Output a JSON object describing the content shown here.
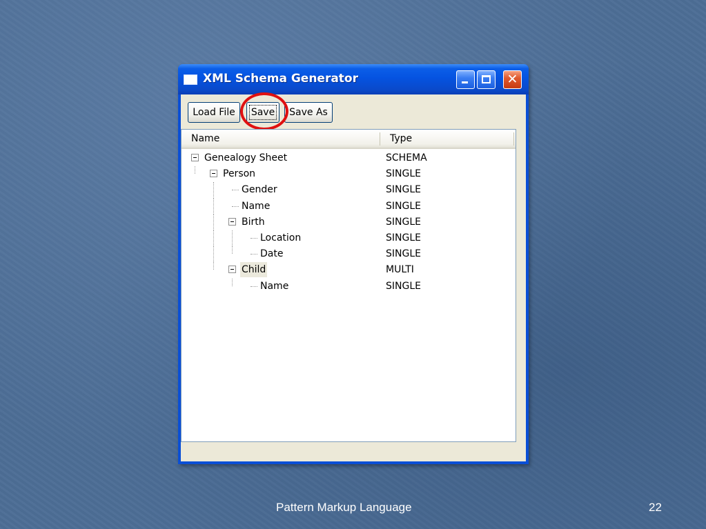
{
  "window": {
    "title": "XML Schema Generator"
  },
  "toolbar": {
    "load_label": "Load File",
    "save_label": "Save",
    "save_as_label": "Save As"
  },
  "list": {
    "columns": [
      "Name",
      "Type"
    ],
    "rows": [
      {
        "name": "Genealogy Sheet",
        "type": "SCHEMA",
        "depth": 0,
        "expanded": true
      },
      {
        "name": "Person",
        "type": "SINGLE",
        "depth": 1,
        "expanded": true
      },
      {
        "name": "Gender",
        "type": "SINGLE",
        "depth": 2,
        "expanded": null
      },
      {
        "name": "Name",
        "type": "SINGLE",
        "depth": 2,
        "expanded": null
      },
      {
        "name": "Birth",
        "type": "SINGLE",
        "depth": 2,
        "expanded": true
      },
      {
        "name": "Location",
        "type": "SINGLE",
        "depth": 3,
        "expanded": null
      },
      {
        "name": "Date",
        "type": "SINGLE",
        "depth": 3,
        "expanded": null
      },
      {
        "name": "Child",
        "type": "MULTI",
        "depth": 2,
        "expanded": true,
        "selected": true
      },
      {
        "name": "Name",
        "type": "SINGLE",
        "depth": 3,
        "expanded": null
      }
    ]
  },
  "slide": {
    "footer": "Pattern Markup Language",
    "page_number": "22"
  },
  "colors": {
    "titlebar": "#0553e1",
    "highlight_ring": "#e01010",
    "background": "#4d6e96"
  }
}
